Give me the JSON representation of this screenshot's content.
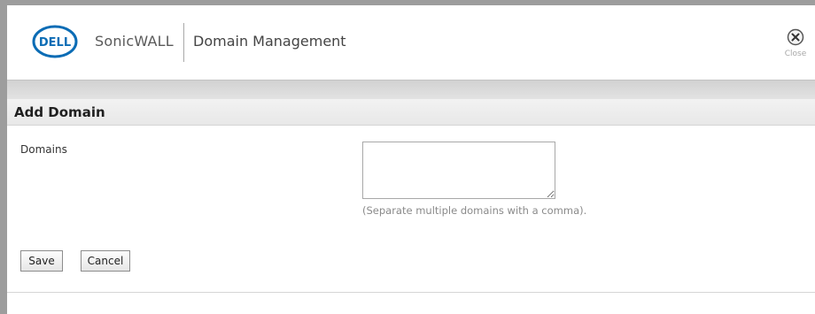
{
  "header": {
    "logo_text": "DELL",
    "brand": "SonicWALL",
    "title": "Domain Management",
    "close_label": "Close"
  },
  "form": {
    "section_title": "Add Domain",
    "domains_label": "Domains",
    "domains_value": "",
    "help_text": "(Separate multiple domains with a comma).",
    "save_label": "Save",
    "cancel_label": "Cancel"
  },
  "colors": {
    "logo_blue": "#0b6cb5",
    "frame_gray": "#9d9d9d"
  },
  "icons": [
    "dell-logo-icon",
    "close-icon"
  ]
}
